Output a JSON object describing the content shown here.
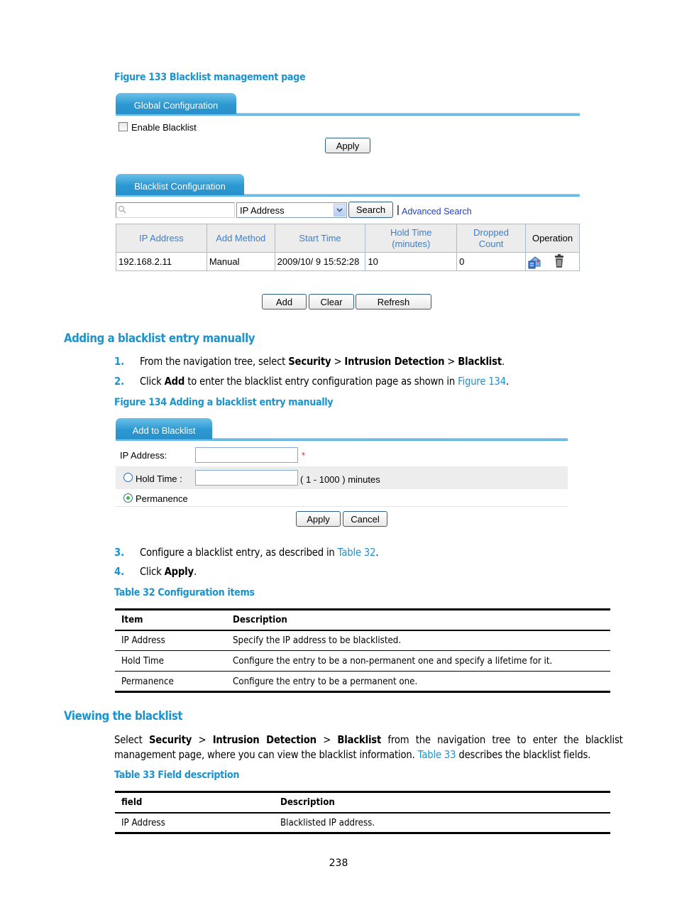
{
  "figure133": {
    "caption": "Figure 133 Blacklist management page",
    "global_tab": "Global Configuration",
    "enable_blacklist_label": "Enable Blacklist",
    "enable_blacklist_checked": false,
    "apply_label": "Apply",
    "blacklist_tab": "Blacklist Configuration",
    "search_input_value": "",
    "search_field_selected": "IP Address",
    "search_label": "Search",
    "separator": "|",
    "advanced_search_label": "Advanced Search",
    "table": {
      "columns": [
        "IP Address",
        "Add Method",
        "Start Time",
        "Hold Time (minutes)",
        "Dropped Count",
        "Operation"
      ],
      "header_lines": {
        "hold_time_1": "Hold Time",
        "hold_time_2": "(minutes)",
        "dropped_1": "Dropped",
        "dropped_2": "Count"
      },
      "rows": [
        {
          "ip": "192.168.2.11",
          "method": "Manual",
          "start": "2009/10/ 9 15:52:28",
          "hold": "10",
          "dropped": "0",
          "operations": [
            "edit-icon",
            "delete-icon"
          ]
        }
      ]
    },
    "buttons": {
      "add": "Add",
      "clear": "Clear",
      "refresh": "Refresh"
    }
  },
  "section1": {
    "heading": "Adding a blacklist entry manually",
    "steps": [
      {
        "num": "1.",
        "parts": [
          "From the navigation tree, select ",
          "Security",
          " > ",
          "Intrusion Detection",
          " > ",
          "Blacklist",
          "."
        ]
      },
      {
        "num": "2.",
        "parts": [
          "Click ",
          "Add",
          " to enter the blacklist entry configuration page as shown in ",
          "Figure 134",
          "."
        ]
      },
      {
        "num": "3.",
        "parts": [
          "Configure a blacklist entry, as described in ",
          "Table 32",
          "."
        ]
      },
      {
        "num": "4.",
        "parts": [
          "Click ",
          "Apply",
          "."
        ]
      }
    ]
  },
  "figure134": {
    "caption": "Figure 134 Adding a blacklist entry manually",
    "tab": "Add to Blacklist",
    "ip_label": "IP Address:",
    "ip_value": "",
    "required_mark": "*",
    "hold_time_label": "Hold Time :",
    "hold_time_value": "",
    "hold_time_range": "( 1 - 1000 ) minutes",
    "hold_time_selected": false,
    "permanence_label": "Permanence",
    "permanence_selected": true,
    "apply_label": "Apply",
    "cancel_label": "Cancel"
  },
  "table32": {
    "caption": "Table 32 Configuration items",
    "headers": [
      "Item",
      "Description"
    ],
    "rows": [
      [
        "IP Address",
        "Specify the IP address to be blacklisted."
      ],
      [
        "Hold Time",
        "Configure the entry to be a non-permanent one and specify a lifetime for it."
      ],
      [
        "Permanence",
        "Configure the entry to be a permanent one."
      ]
    ]
  },
  "section2": {
    "heading": "Viewing the blacklist",
    "para_line1_parts": [
      "Select ",
      "Security",
      " > ",
      "Intrusion Detection",
      " > ",
      "Blacklist",
      " from the navigation tree to enter the blacklist"
    ],
    "para_line2_parts": [
      "management page, where you can view the blacklist information. ",
      "Table 33",
      " describes the blacklist fields."
    ]
  },
  "table33": {
    "caption": "Table 33 Field description",
    "headers": [
      "field",
      "Description"
    ],
    "rows": [
      [
        "IP Address",
        "Blacklisted IP address."
      ]
    ]
  },
  "page_number": "238"
}
